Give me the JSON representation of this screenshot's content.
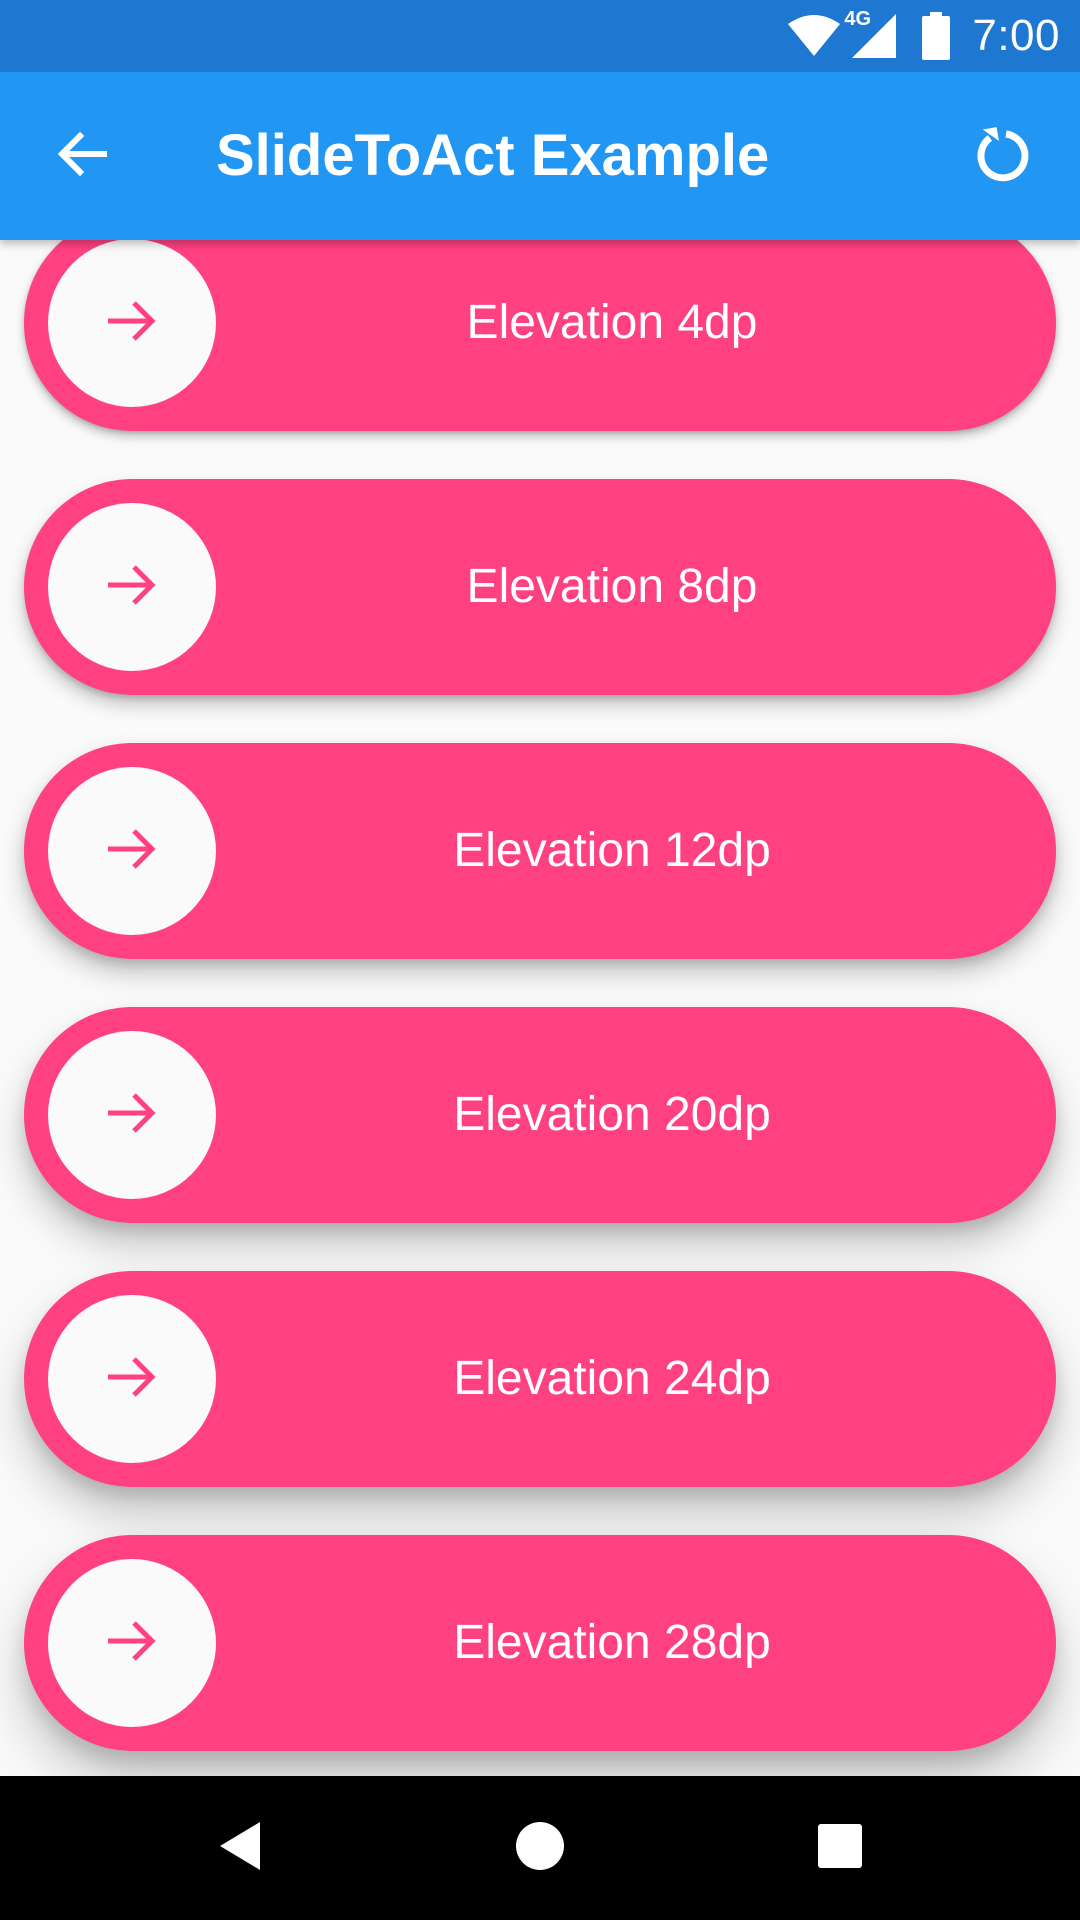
{
  "status_bar": {
    "network": "4G",
    "time": "7:00",
    "icons": [
      "wifi-icon",
      "cellular-signal-icon",
      "battery-icon"
    ]
  },
  "app_bar": {
    "title": "SlideToAct Example",
    "back_icon": "arrow-back-icon",
    "refresh_icon": "refresh-icon",
    "color": "#2196f3"
  },
  "sliders": [
    {
      "label": "Elevation 4dp",
      "elevation_dp": 4
    },
    {
      "label": "Elevation 8dp",
      "elevation_dp": 8
    },
    {
      "label": "Elevation 12dp",
      "elevation_dp": 12
    },
    {
      "label": "Elevation 20dp",
      "elevation_dp": 20
    },
    {
      "label": "Elevation 24dp",
      "elevation_dp": 24
    },
    {
      "label": "Elevation 28dp",
      "elevation_dp": 28
    }
  ],
  "slider_style": {
    "outer_color": "#ff4081",
    "inner_color": "#fafafa",
    "icon": "arrow-forward-icon"
  },
  "nav_bar": {
    "buttons": [
      "back-triangle-icon",
      "home-circle-icon",
      "recents-square-icon"
    ]
  }
}
